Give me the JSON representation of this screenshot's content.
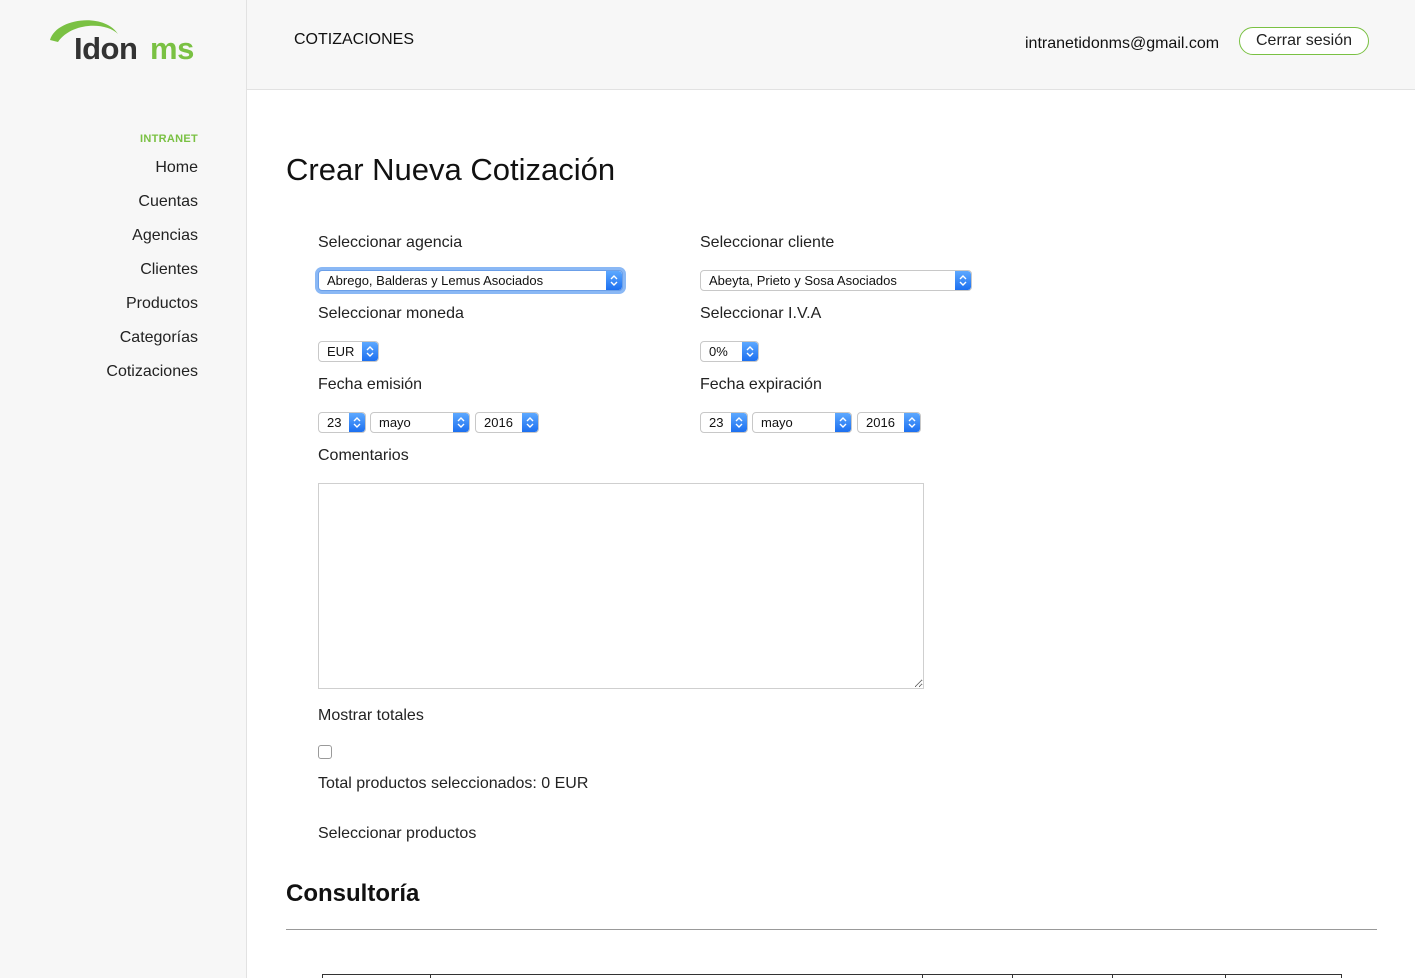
{
  "brand": {
    "name": "idonms",
    "accent": "#7ac143"
  },
  "sidebar": {
    "heading": "INTRANET",
    "items": [
      {
        "label": "Home"
      },
      {
        "label": "Cuentas"
      },
      {
        "label": "Agencias"
      },
      {
        "label": "Clientes"
      },
      {
        "label": "Productos"
      },
      {
        "label": "Categorías"
      },
      {
        "label": "Cotizaciones"
      }
    ]
  },
  "header": {
    "section_title": "COTIZACIONES",
    "user_email": "intranetidonms@gmail.com",
    "logout_label": "Cerrar sesión"
  },
  "form": {
    "title": "Crear Nueva Cotización",
    "agency": {
      "label": "Seleccionar agencia",
      "value": "Abrego, Balderas y Lemus Asociados"
    },
    "client": {
      "label": "Seleccionar cliente",
      "value": "Abeyta, Prieto y Sosa Asociados"
    },
    "currency": {
      "label": "Seleccionar moneda",
      "value": "EUR"
    },
    "vat": {
      "label": "Seleccionar I.V.A",
      "value": "0%"
    },
    "issue_date": {
      "label": "Fecha emisión",
      "day": "23",
      "month": "mayo",
      "year": "2016"
    },
    "expiry_date": {
      "label": "Fecha expiración",
      "day": "23",
      "month": "mayo",
      "year": "2016"
    },
    "comments": {
      "label": "Comentarios",
      "value": ""
    },
    "show_totals": {
      "label": "Mostrar totales",
      "checked": false
    },
    "total_text": "Total productos seleccionados: 0 EUR",
    "select_products_label": "Seleccionar productos"
  },
  "products_section": {
    "title": "Consultoría"
  }
}
